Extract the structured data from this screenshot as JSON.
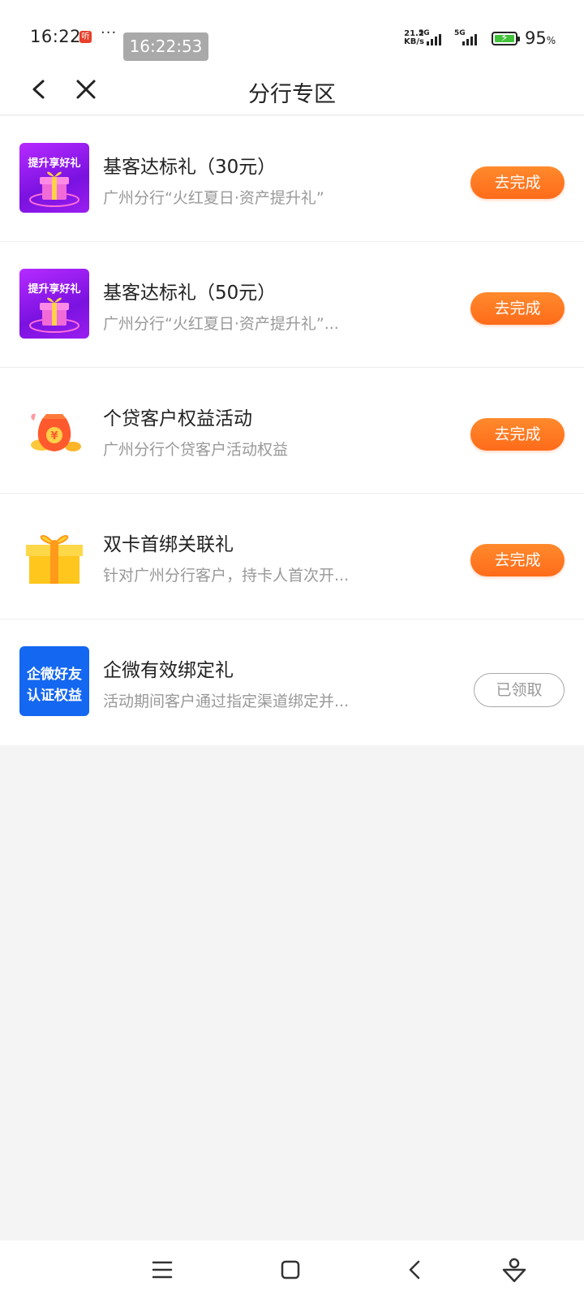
{
  "status_bar": {
    "time": "16:22",
    "notification_badge": "听",
    "more_dots": "···",
    "overlay_clock": "16:22:53",
    "net_speed_value": "21.2",
    "net_speed_unit": "KB/s",
    "signal_label_1": "5G",
    "signal_label_2": "5G",
    "battery_value": "95",
    "battery_unit": "%",
    "battery_level": 0.95,
    "battery_color": "#43c23b"
  },
  "nav": {
    "back_icon": "chevron-left-icon",
    "close_icon": "close-icon",
    "title": "分行专区"
  },
  "items": [
    {
      "icon": "gift-box-purple-icon",
      "icon_text": "提升享好礼",
      "title": "基客达标礼（30元）",
      "desc": "广州分行“火红夏日·资产提升礼”",
      "action": "去完成",
      "state": "todo"
    },
    {
      "icon": "gift-box-purple-icon",
      "icon_text": "提升享好礼",
      "title": "基客达标礼（50元）",
      "desc": "广州分行“火红夏日·资产提升礼”...",
      "action": "去完成",
      "state": "todo"
    },
    {
      "icon": "money-bag-icon",
      "icon_text": "¥",
      "title": "个贷客户权益活动",
      "desc": "广州分行个贷客户活动权益",
      "action": "去完成",
      "state": "todo"
    },
    {
      "icon": "gift-box-gold-icon",
      "title": "双卡首绑关联礼",
      "desc": "针对广州分行客户，持卡人首次开...",
      "action": "去完成",
      "state": "todo"
    },
    {
      "icon": "wecom-badge-icon",
      "icon_line_1": "企微好友",
      "icon_line_2": "认证权益",
      "title": "企微有效绑定礼",
      "desc": "活动期间客户通过指定渠道绑定并...",
      "action": "已领取",
      "state": "claimed"
    }
  ],
  "colors": {
    "accent": "#ff7a22",
    "claimed_border": "#a8a8a8",
    "page_background": "#f4f4f4"
  },
  "system_nav": {
    "menu_icon": "menu-icon",
    "home_icon": "home-square-icon",
    "back_icon": "back-chevron-icon",
    "assistant_icon": "assistant-icon"
  }
}
